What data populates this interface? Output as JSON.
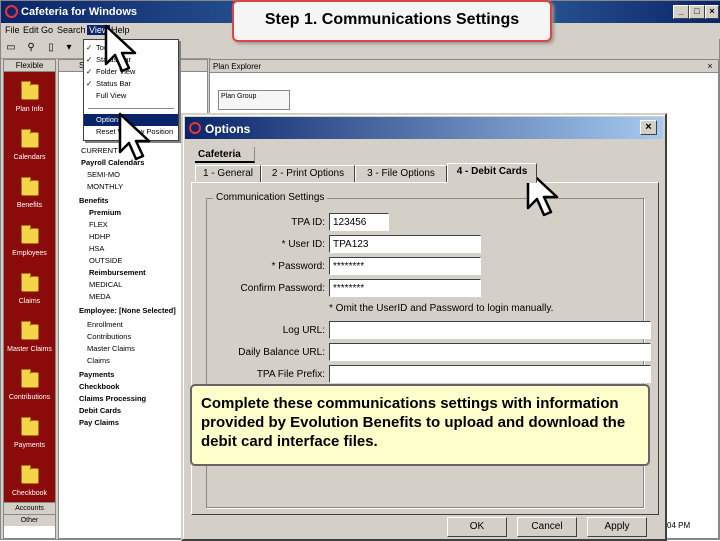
{
  "app": {
    "title": "Cafeteria for Windows"
  },
  "callouts": {
    "step": "Step 1.  Communications Settings",
    "info": "Complete these communications settings with information provided by Evolution Benefits to upload and download the debit card interface files."
  },
  "menubar": {
    "items": [
      "File",
      "Edit",
      "Go",
      "Search",
      "View",
      "Help"
    ]
  },
  "view_menu": {
    "items": [
      {
        "label": "Toolbar",
        "checked": true
      },
      {
        "label": "Status Bar",
        "checked": true
      },
      {
        "label": "Folder View",
        "checked": true
      },
      {
        "label": "Status Bar",
        "checked": true
      },
      {
        "label": "Full View",
        "checked": false
      }
    ],
    "options": "Options...",
    "reset": "Reset Window Position"
  },
  "sidebar": {
    "header": "Flexible",
    "items": [
      "Plan Info",
      "Calendars",
      "Benefits",
      "Employees",
      "Claims",
      "Master Claims",
      "Contributions",
      "Payments",
      "Checkbook"
    ],
    "footer1": "Accounts",
    "footer2": "Other"
  },
  "tree": {
    "header": "Salary",
    "nodes": [
      {
        "label": "CURRENT",
        "bold": false
      },
      {
        "label": "Payroll Calendars",
        "bold": true
      },
      {
        "label": "SEMI-MO",
        "bold": false
      },
      {
        "label": "MONTHLY",
        "bold": false
      },
      {
        "label": "Benefits",
        "bold": true
      },
      {
        "label": "Premium",
        "bold": true
      },
      {
        "label": "FLEX",
        "bold": false
      },
      {
        "label": "HDHP",
        "bold": false
      },
      {
        "label": "HSA",
        "bold": false
      },
      {
        "label": "OUTSIDE",
        "bold": false
      },
      {
        "label": "Reimbursement",
        "bold": true
      },
      {
        "label": "MEDICAL",
        "bold": false
      },
      {
        "label": "MEDA",
        "bold": false
      },
      {
        "label": "Employee: [None Selected]",
        "bold": true
      },
      {
        "label": "Enrollment",
        "bold": false
      },
      {
        "label": "Contributions",
        "bold": false
      },
      {
        "label": "Master Claims",
        "bold": false
      },
      {
        "label": "Claims",
        "bold": false
      },
      {
        "label": "Payments",
        "bold": true
      },
      {
        "label": "Checkbook",
        "bold": true
      },
      {
        "label": "Claims Processing",
        "bold": true
      },
      {
        "label": "Debit Cards",
        "bold": true
      },
      {
        "label": "Pay Claims",
        "bold": true
      }
    ]
  },
  "plan_explorer": {
    "title": "Plan Explorer",
    "grid_header": "Plan Group"
  },
  "dialog": {
    "title": "Options",
    "section_tab": "Cafeteria",
    "tabs": [
      "1 - General",
      "2 - Print Options",
      "3 - File Options",
      "4 - Debit Cards"
    ],
    "active_tab": 3,
    "group_label": "Communication Settings",
    "fields": {
      "tpa_id": {
        "label": "TPA ID:",
        "value": "123456"
      },
      "user_id": {
        "label": "* User ID:",
        "value": "TPA123"
      },
      "password": {
        "label": "* Password:",
        "value": "********"
      },
      "confirm_password": {
        "label": "Confirm Password:",
        "value": "********"
      },
      "note": "* Omit the UserID and Password to login manually.",
      "log_url": {
        "label": "Log URL:",
        "value": ""
      },
      "daily_balance_url": {
        "label": "Daily Balance URL:",
        "value": ""
      },
      "tpa_file_prefix": {
        "label": "TPA File Prefix:",
        "value": ""
      }
    },
    "buttons": {
      "ok": "OK",
      "cancel": "Cancel",
      "apply": "Apply"
    }
  },
  "status": {
    "clock": "04 PM"
  },
  "colors": {
    "titlebar": "#0a246a",
    "sidebar": "#8b0a0a",
    "callout_bg": "#ffffcc",
    "callout_border_red": "#dd4444"
  }
}
